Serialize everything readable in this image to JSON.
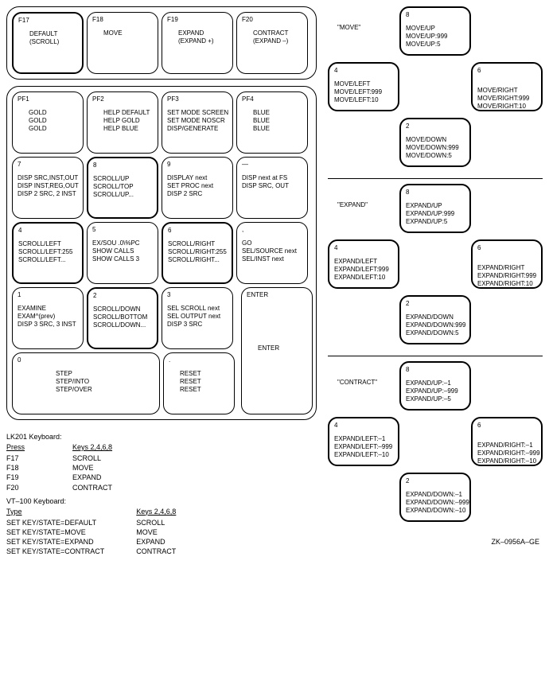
{
  "keypad": {
    "f17": {
      "num": "F17",
      "lines": [
        "DEFAULT",
        "(SCROLL)"
      ]
    },
    "f18": {
      "num": "F18",
      "lines": [
        "MOVE"
      ]
    },
    "f19": {
      "num": "F19",
      "lines": [
        "EXPAND",
        "(EXPAND +)"
      ]
    },
    "f20": {
      "num": "F20",
      "lines": [
        "CONTRACT",
        "(EXPAND –)"
      ]
    },
    "pf1": {
      "num": "PF1",
      "lines": [
        "GOLD",
        "GOLD",
        "GOLD"
      ]
    },
    "pf2": {
      "num": "PF2",
      "lines": [
        "HELP DEFAULT",
        "HELP GOLD",
        "HELP BLUE"
      ]
    },
    "pf3": {
      "num": "PF3",
      "lines": [
        "SET MODE SCREEN",
        "SET MODE NOSCR",
        "DISP/GENERATE"
      ]
    },
    "pf4": {
      "num": "PF4",
      "lines": [
        "BLUE",
        "BLUE",
        "BLUE"
      ]
    },
    "k7": {
      "num": "7",
      "lines": [
        "DISP SRC,INST,OUT",
        "DISP INST,REG,OUT",
        "DISP 2 SRC, 2 INST"
      ]
    },
    "k8": {
      "num": "8",
      "lines": [
        "SCROLL/UP",
        "SCROLL/TOP",
        "SCROLL/UP..."
      ]
    },
    "k9": {
      "num": "9",
      "lines": [
        "DISPLAY next",
        "SET PROC next",
        "DISP 2 SRC"
      ]
    },
    "kmn": {
      "num": "—",
      "lines": [
        "DISP next at FS",
        "",
        "DISP SRC, OUT"
      ]
    },
    "k4": {
      "num": "4",
      "lines": [
        "SCROLL/LEFT",
        "SCROLL/LEFT:255",
        "SCROLL/LEFT..."
      ]
    },
    "k5": {
      "num": "5",
      "lines": [
        "EX/SOU .0\\%PC",
        "SHOW CALLS",
        "SHOW CALLS 3"
      ]
    },
    "k6": {
      "num": "6",
      "lines": [
        "SCROLL/RIGHT",
        "SCROLL/RIGHT:255",
        "SCROLL/RIGHT..."
      ]
    },
    "kcm": {
      "num": ",",
      "lines": [
        "GO",
        "SEL/SOURCE next",
        "SEL/INST next"
      ]
    },
    "k1": {
      "num": "1",
      "lines": [
        "EXAMINE",
        "EXAM^(prev)",
        "DISP 3 SRC, 3 INST"
      ]
    },
    "k2": {
      "num": "2",
      "lines": [
        "SCROLL/DOWN",
        "SCROLL/BOTTOM",
        "SCROLL/DOWN..."
      ]
    },
    "k3": {
      "num": "3",
      "lines": [
        "SEL SCROLL next",
        "SEL OUTPUT next",
        "DISP 3 SRC"
      ]
    },
    "kent": {
      "num": "ENTER",
      "lines": [
        "",
        "",
        "",
        "ENTER"
      ]
    },
    "k0": {
      "num": "0",
      "lines": [
        "STEP",
        "STEP/INTO",
        "STEP/OVER"
      ]
    },
    "kpd": {
      "num": ".",
      "lines": [
        "RESET",
        "RESET",
        "RESET"
      ]
    }
  },
  "legend": {
    "lk201": {
      "title": "LK201 Keyboard:",
      "left_header": "Press",
      "left": [
        "F17",
        "F18",
        "F19",
        "F20"
      ],
      "right_header": "Keys 2,4,6,8",
      "right": [
        "SCROLL",
        "MOVE",
        "EXPAND",
        "CONTRACT"
      ]
    },
    "vt100": {
      "title": "VT–100 Keyboard:",
      "left_header": "Type",
      "left": [
        "SET KEY/STATE=DEFAULT",
        "SET KEY/STATE=MOVE",
        "SET KEY/STATE=EXPAND",
        "SET KEY/STATE=CONTRACT"
      ],
      "right_header": "Keys 2,4,6,8",
      "right": [
        "SCROLL",
        "MOVE",
        "EXPAND",
        "CONTRACT"
      ]
    }
  },
  "crosses": [
    {
      "label": "\"MOVE\"",
      "up": {
        "num": "8",
        "lines": [
          "MOVE/UP",
          "MOVE/UP:999",
          "MOVE/UP:5"
        ]
      },
      "left": {
        "num": "4",
        "lines": [
          "MOVE/LEFT",
          "MOVE/LEFT:999",
          "MOVE/LEFT:10"
        ]
      },
      "right": {
        "num": "6",
        "lines": [
          "MOVE/RIGHT",
          "MOVE/RIGHT:999",
          "MOVE/RIGHT:10"
        ]
      },
      "down": {
        "num": "2",
        "lines": [
          "MOVE/DOWN",
          "MOVE/DOWN:999",
          "MOVE/DOWN:5"
        ]
      }
    },
    {
      "label": "\"EXPAND\"",
      "up": {
        "num": "8",
        "lines": [
          "EXPAND/UP",
          "EXPAND/UP:999",
          "EXPAND/UP:5"
        ]
      },
      "left": {
        "num": "4",
        "lines": [
          "EXPAND/LEFT",
          "EXPAND/LEFT:999",
          "EXPAND/LEFT:10"
        ]
      },
      "right": {
        "num": "6",
        "lines": [
          "EXPAND/RIGHT",
          "EXPAND/RIGHT:999",
          "EXPAND/RIGHT:10"
        ]
      },
      "down": {
        "num": "2",
        "lines": [
          "EXPAND/DOWN",
          "EXPAND/DOWN:999",
          "EXPAND/DOWN:5"
        ]
      }
    },
    {
      "label": "\"CONTRACT\"",
      "up": {
        "num": "8",
        "lines": [
          "EXPAND/UP:–1",
          "EXPAND/UP:–999",
          "EXPAND/UP:–5"
        ]
      },
      "left": {
        "num": "4",
        "lines": [
          "EXPAND/LEFT:–1",
          "EXPAND/LEFT:–999",
          "EXPAND/LEFT:–10"
        ]
      },
      "right": {
        "num": "6",
        "lines": [
          "EXPAND/RIGHT:–1",
          "EXPAND/RIGHT:–999",
          "EXPAND/RIGHT:–10"
        ]
      },
      "down": {
        "num": "2",
        "lines": [
          "EXPAND/DOWN:–1",
          "EXPAND/DOWN:–999",
          "EXPAND/DOWN:–10"
        ]
      }
    }
  ],
  "figure_id": "ZK–0956A–GE"
}
